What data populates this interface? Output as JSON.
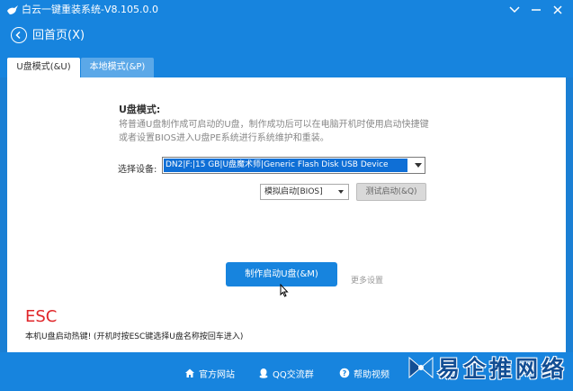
{
  "window": {
    "title": "白云一键重装系统-V8.105.0.0",
    "controls": [
      "menu-icon",
      "minimize-icon",
      "close-icon"
    ]
  },
  "nav": {
    "back_label": "回首页(X)"
  },
  "tabs": [
    {
      "label": "U盘模式(&U)",
      "active": true
    },
    {
      "label": "本地模式(&P)",
      "active": false
    }
  ],
  "usb": {
    "section_title": "U盘模式:",
    "description": "将普通U盘制作成可启动的U盘，制作成功后可以在电脑开机时使用启动快捷键或者设置BIOS进入U盘PE系统进行系统维护和重装。",
    "device_label": "选择设备:",
    "device_value": "DN2|F:|15 GB|U盘魔术师|Generic Flash Disk USB Device",
    "boot_mode_value": "模拟启动[BIOS]",
    "test_button": "测试启动(&Q)",
    "make_button": "制作启动U盘(&M)",
    "more_settings": "更多设置"
  },
  "hotkey": {
    "key": "ESC",
    "note": "本机U盘启动热键!  (开机时按ESC键选择U盘名称按回车进入)"
  },
  "footer": {
    "links": [
      "官方网站",
      "QQ交流群",
      "帮助视频"
    ]
  },
  "watermark": {
    "text": "易企推网络"
  },
  "colors": {
    "brand": "#1784de",
    "selection": "#0f6fd6",
    "hotkey_red": "#e0262a"
  }
}
